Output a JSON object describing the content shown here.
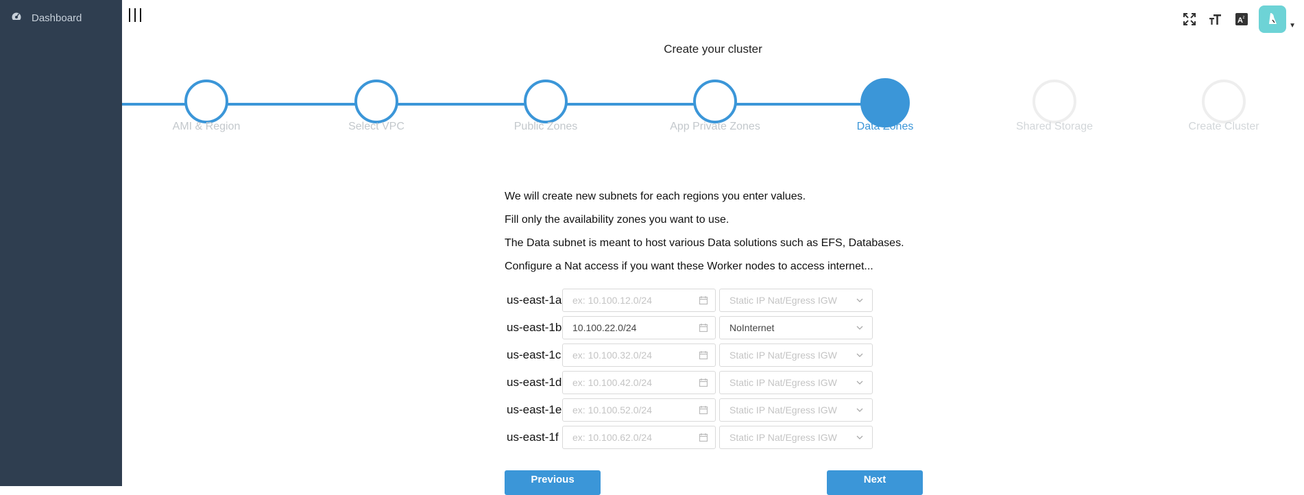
{
  "sidebar": {
    "items": [
      {
        "label": "Dashboard",
        "icon": "dashboard-icon"
      }
    ]
  },
  "topbar": {
    "icons": [
      "fullscreen-icon",
      "font-size-icon",
      "translate-icon"
    ],
    "avatar": "user-avatar"
  },
  "page": {
    "title": "Create your cluster"
  },
  "stepper": {
    "steps": [
      {
        "label": "AMI & Region",
        "state": "done"
      },
      {
        "label": "Select VPC",
        "state": "done"
      },
      {
        "label": "Public Zones",
        "state": "done"
      },
      {
        "label": "App Private Zones",
        "state": "done"
      },
      {
        "label": "Data Zones",
        "state": "active"
      },
      {
        "label": "Shared Storage",
        "state": "future"
      },
      {
        "label": "Create Cluster",
        "state": "future"
      }
    ]
  },
  "description": {
    "lines": [
      "We will create new subnets for each regions you enter values.",
      "Fill only the availability zones you want to use.",
      "The Data subnet is meant to host various Data solutions such as EFS, Databases.",
      "Configure a Nat access if you want these Worker nodes to access internet..."
    ]
  },
  "zones": [
    {
      "name": "us-east-1a",
      "cidr_value": "",
      "cidr_placeholder": "ex: 10.100.12.0/24",
      "nat": "Static IP Nat/Egress IGW",
      "nat_selected": false
    },
    {
      "name": "us-east-1b",
      "cidr_value": "10.100.22.0/24",
      "cidr_placeholder": "",
      "nat": "NoInternet",
      "nat_selected": true
    },
    {
      "name": "us-east-1c",
      "cidr_value": "",
      "cidr_placeholder": "ex: 10.100.32.0/24",
      "nat": "Static IP Nat/Egress IGW",
      "nat_selected": false
    },
    {
      "name": "us-east-1d",
      "cidr_value": "",
      "cidr_placeholder": "ex: 10.100.42.0/24",
      "nat": "Static IP Nat/Egress IGW",
      "nat_selected": false
    },
    {
      "name": "us-east-1e",
      "cidr_value": "",
      "cidr_placeholder": "ex: 10.100.52.0/24",
      "nat": "Static IP Nat/Egress IGW",
      "nat_selected": false
    },
    {
      "name": "us-east-1f",
      "cidr_value": "",
      "cidr_placeholder": "ex: 10.100.62.0/24",
      "nat": "Static IP Nat/Egress IGW",
      "nat_selected": false
    }
  ],
  "buttons": {
    "previous": "Previous",
    "next": "Next"
  },
  "colors": {
    "accent": "#3b96d8",
    "sidebar": "#2f3e50",
    "avatar": "#6dd3d6"
  }
}
